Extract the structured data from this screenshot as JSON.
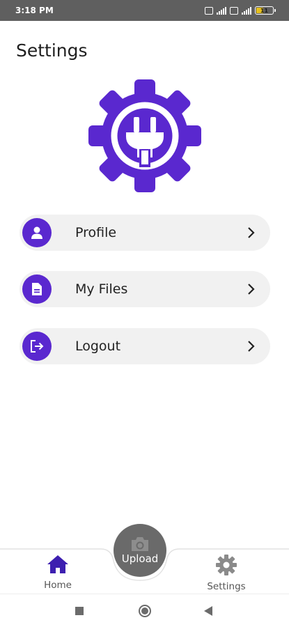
{
  "status_bar": {
    "time": "3:18 PM",
    "battery_level": "11",
    "battery_fill_fraction": 0.4,
    "battery_color": "#e6c01e"
  },
  "header": {
    "title": "Settings"
  },
  "logo": {
    "icon": "gear-plug-logo-icon",
    "color": "#5a28cf"
  },
  "menu": {
    "items": [
      {
        "label": "Profile",
        "icon": "person-icon"
      },
      {
        "label": "My Files",
        "icon": "document-icon"
      },
      {
        "label": "Logout",
        "icon": "logout-icon"
      }
    ],
    "accent_color": "#5a28cf"
  },
  "bottom_nav": {
    "home_label": "Home",
    "upload_label": "Upload",
    "settings_label": "Settings",
    "home_color": "#3d1fb0",
    "inactive_color": "#8a8a8a"
  },
  "system_nav": {
    "recents": "square-icon",
    "home": "circle-icon",
    "back": "triangle-back-icon"
  }
}
